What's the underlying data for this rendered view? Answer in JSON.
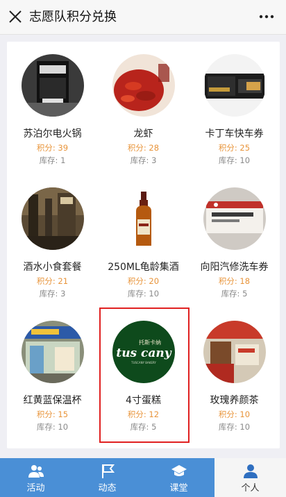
{
  "header": {
    "title": "志愿队积分兑换",
    "close_icon": "close-icon",
    "more_icon": "more-dots-icon"
  },
  "products": [
    {
      "name": "苏泊尔电火锅",
      "points": "积分: 39",
      "stock": "库存: 1",
      "image": "storefront-photo"
    },
    {
      "name": "龙虾",
      "points": "积分: 28",
      "stock": "库存: 3",
      "image": "crayfish-photo"
    },
    {
      "name": "卡丁车快车券",
      "points": "积分: 25",
      "stock": "库存: 10",
      "image": "go-kart-voucher-photo"
    },
    {
      "name": "酒水小食套餐",
      "points": "积分: 21",
      "stock": "库存: 3",
      "image": "bar-interior-photo"
    },
    {
      "name": "250ML龟龄集酒",
      "points": "积分: 20",
      "stock": "库存: 10",
      "image": "liquor-bottle-photo"
    },
    {
      "name": "向阳汽修洗车券",
      "points": "积分: 18",
      "stock": "库存: 5",
      "image": "car-wash-voucher-photo"
    },
    {
      "name": "红黄蓝保温杯",
      "points": "积分: 15",
      "stock": "库存: 10",
      "image": "shop-front-photo"
    },
    {
      "name": "4寸蛋糕",
      "points": "积分: 12",
      "stock": "库存: 5",
      "image": "tuscany-bakery-logo"
    },
    {
      "name": "玫瑰养颜茶",
      "points": "积分: 10",
      "stock": "库存: 10",
      "image": "tea-shop-photo"
    }
  ],
  "logo_text": {
    "main": "tus cany",
    "cn": "托斯卡纳",
    "sub": "TUSCANY BAKERY"
  },
  "tabs": [
    {
      "label": "活动",
      "icon": "people-icon",
      "active": false
    },
    {
      "label": "动态",
      "icon": "flag-icon",
      "active": false
    },
    {
      "label": "课堂",
      "icon": "graduation-cap-icon",
      "active": false
    },
    {
      "label": "个人",
      "icon": "person-icon",
      "active": true
    }
  ],
  "colors": {
    "points": "#e8943a",
    "tabbar": "#4a8fd6",
    "highlight": "#e02020"
  }
}
